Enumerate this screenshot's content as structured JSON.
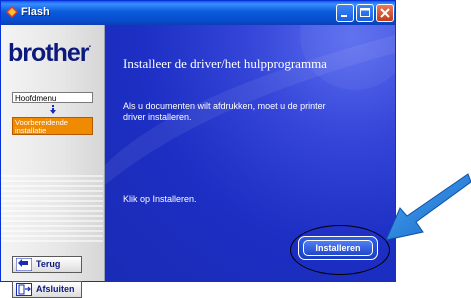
{
  "window": {
    "title": "Flash",
    "app_icon": "flash-icon",
    "buttons": [
      "minimize-icon",
      "maximize-icon",
      "close-icon"
    ]
  },
  "sidebar": {
    "logo": "brother",
    "logo_mark": ".",
    "nav": {
      "main_label": "Hoofdmenu",
      "arrow_icon": "down-arrow-icon",
      "current_label": "Voorbereidende installatie",
      "current_color": "#f08a00"
    },
    "buttons": {
      "back_label": "Terug",
      "back_icon": "back-arrow-icon",
      "close_label": "Afsluiten",
      "close_icon": "exit-door-icon"
    }
  },
  "main": {
    "heading": "Installeer de driver/het hulpprogramma",
    "description": "Als u documenten wilt afdrukken, moet u de printer driver installeren.",
    "instruction": "Klik op Installeren.",
    "install_label": "Installeren"
  },
  "colors": {
    "accent": "#1d2fc4",
    "callout_arrow": "#1e7de0"
  }
}
